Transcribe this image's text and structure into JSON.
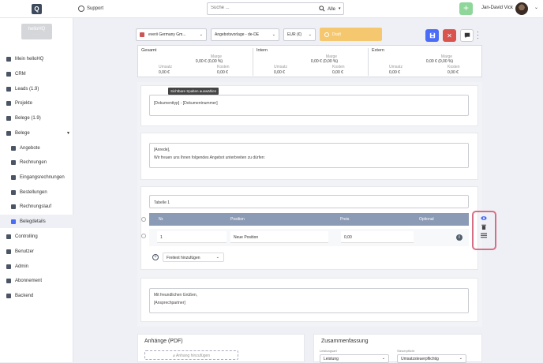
{
  "topbar": {
    "logo": "Q",
    "support": "Support",
    "search_placeholder": "Suche ...",
    "search_scope": "Alle",
    "plus": "+",
    "user_name": "Jan-David Vick"
  },
  "sidebar": {
    "brand_title": "helloHQ",
    "brand_sub": "......",
    "items": [
      {
        "label": "Mein helloHQ"
      },
      {
        "label": "CRM"
      },
      {
        "label": "Leads (1.9)"
      },
      {
        "label": "Projekte"
      },
      {
        "label": "Belege (1.9)"
      },
      {
        "label": "Belege"
      },
      {
        "label": "Angebote"
      },
      {
        "label": "Rechnungen"
      },
      {
        "label": "Eingangsrechnungen"
      },
      {
        "label": "Bestellungen"
      },
      {
        "label": "Rechnungslauf"
      },
      {
        "label": "Belegdetails"
      },
      {
        "label": "Controlling"
      },
      {
        "label": "Benutzer"
      },
      {
        "label": "Admin"
      },
      {
        "label": "Abonnement"
      },
      {
        "label": "Backend"
      }
    ]
  },
  "toolbar": {
    "company": "everii Germany Gm...",
    "template": "Angebotsvorlage - de-DE",
    "currency": "EUR (€)",
    "status": "Draft"
  },
  "summary": {
    "cols": [
      {
        "title": "Gesamt",
        "marge_label": "Marge",
        "marge_value": "0,00 € (0,00 %)",
        "umsatz_label": "Umsatz",
        "umsatz_value": "0,00 €",
        "kosten_label": "Kosten",
        "kosten_value": "0,00 €"
      },
      {
        "title": "Intern",
        "marge_label": "Marge",
        "marge_value": "0,00 € (0,00 %)",
        "umsatz_label": "Umsatz",
        "umsatz_value": "0,00 €",
        "kosten_label": "Kosten",
        "kosten_value": "0,00 €"
      },
      {
        "title": "Extern",
        "marge_label": "Marge",
        "marge_value": "0,00 € (0,00 %)",
        "umsatz_label": "Umsatz",
        "umsatz_value": "0,00 €",
        "kosten_label": "Kosten",
        "kosten_value": "0,00 €"
      }
    ]
  },
  "document": {
    "tooltip": "Sichtbare Spalten auswählen",
    "title_box": "[Dokumenttyp] - [Dokumentnummer]",
    "intro_line1": "[Anrede],",
    "intro_line2": "Wir freuen uns Ihnen folgendes Angebot unterbreiten zu dürfen:",
    "table_name": "Tabelle 1",
    "table_headers": {
      "nr": "Nr.",
      "position": "Position",
      "preis": "Preis",
      "optional": "Optional"
    },
    "row": {
      "nr": "1",
      "position": "Neue Position",
      "preis": "0,00"
    },
    "info": "i",
    "freitext": "Freitext hinzufügen",
    "closing_line1": "Mit freundlichen Grüßen,",
    "closing_line2": "[Ansprechpartner]"
  },
  "bottom": {
    "attachments_title": "Anhänge (PDF)",
    "upload": "Anhang hinzufügen",
    "summary_title": "Zusammenfassung",
    "leistung_label": "Leistungsart",
    "leistung_value": "Leistung",
    "steuer_label": "Steuerpflicht",
    "steuer_value": "Umsatzsteuerpflichtig"
  },
  "colors": {
    "accent_blue": "#4a6cf7",
    "danger": "#d9534f",
    "draft": "#f5c870",
    "plus_green": "#8fd69a",
    "highlight": "#d66f86"
  }
}
